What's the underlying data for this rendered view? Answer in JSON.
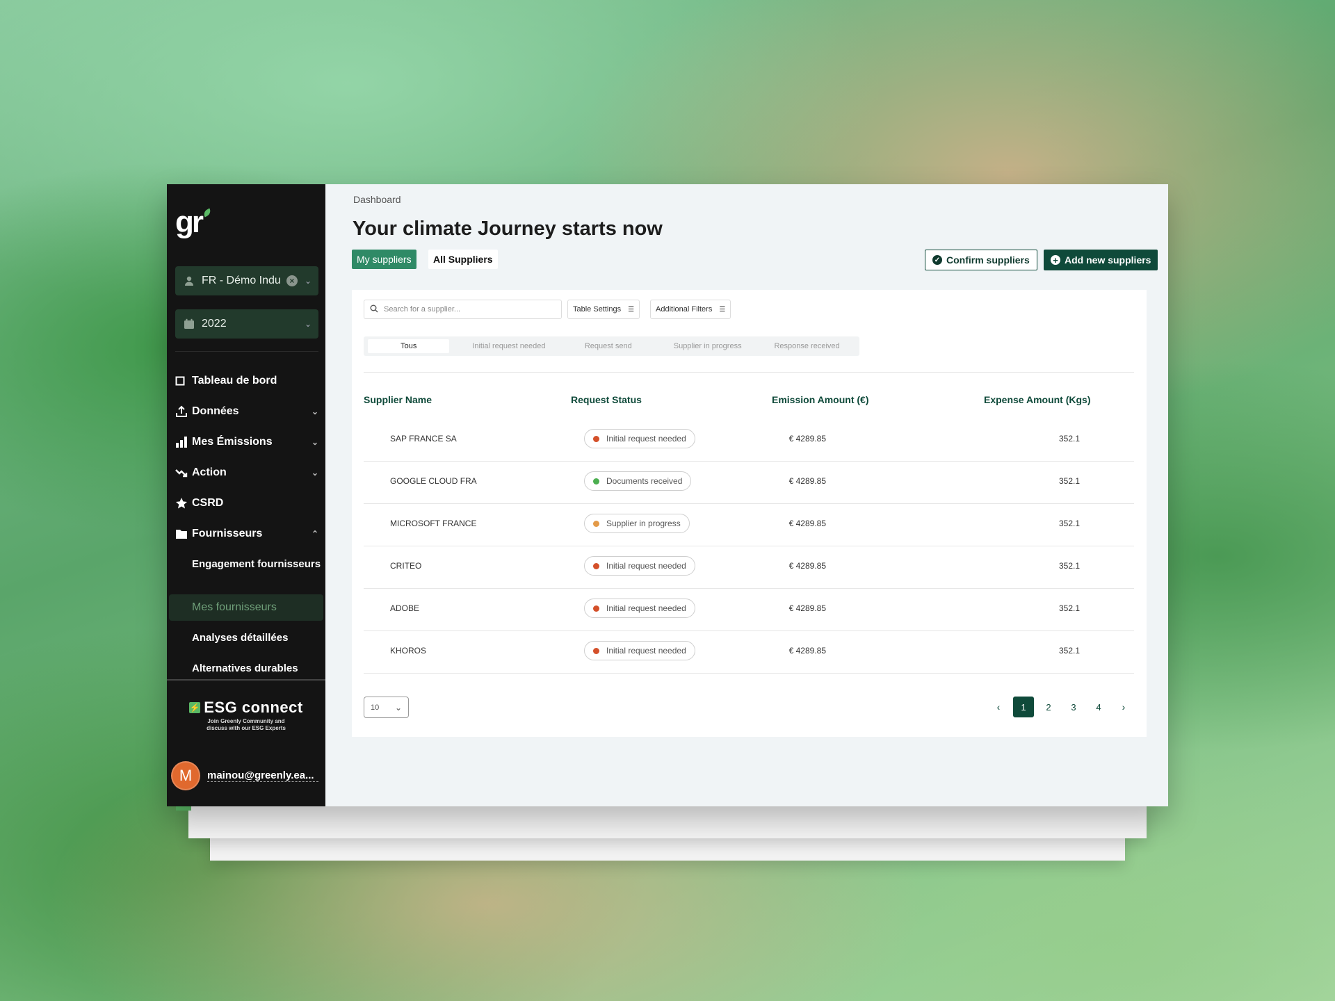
{
  "sidebar": {
    "logo": "gr",
    "org_select": "FR - Démo Indu",
    "year_select": "2022",
    "nav": [
      {
        "label": "Tableau de bord",
        "icon": "square-icon"
      },
      {
        "label": "Données",
        "icon": "upload-icon"
      },
      {
        "label": "Mes Émissions",
        "icon": "bar-chart-icon"
      },
      {
        "label": "Action",
        "icon": "trend-down-icon"
      },
      {
        "label": "CSRD",
        "icon": "star-icon"
      },
      {
        "label": "Fournisseurs",
        "icon": "folder-icon"
      }
    ],
    "sub_nav": [
      {
        "label": "Engagement fournisseurs"
      },
      {
        "label": "Mes fournisseurs"
      },
      {
        "label": "Analyses détaillées"
      },
      {
        "label": "Alternatives durables"
      }
    ],
    "esg_title": "ESG connect",
    "esg_sub_line1": "Join Greenly Community and",
    "esg_sub_line2": "discuss with our ESG Experts",
    "user_initial": "M",
    "user_email": "mainou@greenly.ea..."
  },
  "main": {
    "breadcrumb": "Dashboard",
    "title": "Your climate Journey starts now",
    "tab_my": "My suppliers",
    "tab_all": "All Suppliers",
    "confirm_label": "Confirm suppliers",
    "add_label": "Add new suppliers",
    "search_placeholder": "Search for a supplier...",
    "table_settings": "Table Settings",
    "additional_filters": "Additional Filters",
    "status_tabs": [
      "Tous",
      "Initial request needed",
      "Request send",
      "Supplier in progress",
      "Response received"
    ],
    "columns": [
      "Supplier Name",
      "Request Status",
      "Emission Amount (€)",
      "Expense Amount (Kgs)"
    ],
    "rows": [
      {
        "name": "SAP FRANCE SA",
        "status": "Initial request needed",
        "status_color": "#d4502a",
        "emission": "€ 4289.85",
        "expense": "352.1"
      },
      {
        "name": "GOOGLE CLOUD FRA",
        "status": "Documents received",
        "status_color": "#4caf50",
        "emission": "€ 4289.85",
        "expense": "352.1"
      },
      {
        "name": "MICROSOFT FRANCE",
        "status": "Supplier in progress",
        "status_color": "#e39a48",
        "emission": "€ 4289.85",
        "expense": "352.1"
      },
      {
        "name": "CRITEO",
        "status": "Initial request needed",
        "status_color": "#d4502a",
        "emission": "€ 4289.85",
        "expense": "352.1"
      },
      {
        "name": "ADOBE",
        "status": "Initial request needed",
        "status_color": "#d4502a",
        "emission": "€ 4289.85",
        "expense": "352.1"
      },
      {
        "name": "KHOROS",
        "status": "Initial request needed",
        "status_color": "#d4502a",
        "emission": "€ 4289.85",
        "expense": "352.1"
      }
    ],
    "per_page": "10",
    "pages": [
      "1",
      "2",
      "3",
      "4"
    ],
    "current_page": "1"
  },
  "colors": {
    "brand_dark": "#0f4a3a",
    "brand_green": "#2f8a66",
    "sidebar_bg": "#141414"
  }
}
